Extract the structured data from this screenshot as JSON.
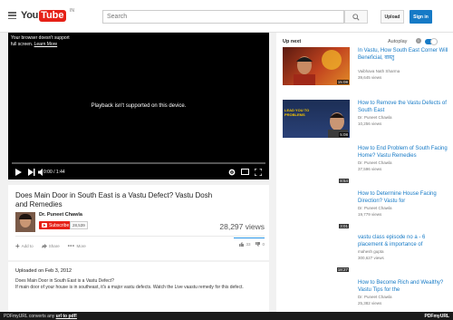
{
  "masthead": {
    "logo_you": "You",
    "logo_tube": "Tube",
    "logo_cc": "IN",
    "search_placeholder": "Search",
    "upload_label": "Upload",
    "signin_label": "Sign in"
  },
  "player": {
    "fullscreen_notice": "Your browser doesn't support full screen.",
    "learn_more": "Learn More",
    "playback_message": "Playback isn't supported on this device.",
    "time": "0:00 / 1:44"
  },
  "video": {
    "title": "Does Main Door in South East is a Vastu Defect? Vastu Dosh and Remedies",
    "channel": "Dr. Puneet Chawla",
    "subscribe_label": "Subscribe",
    "subscriber_count": "28,539",
    "views": "28,297 views",
    "add_to_label": "Add to",
    "share_label": "Share",
    "more_label": "More",
    "likes": "33",
    "dislikes": "0"
  },
  "description": {
    "uploaded": "Uploaded on Feb 3, 2012",
    "line1": "Does Main Door in South East is a Vastu Defect?",
    "line2": "If main door of your house is in southeast, it's a major vastu defects. Watch the Live vaastu remedy for this defect.",
    "show_more": "SHOW MORE"
  },
  "sidebar": {
    "upnext_label": "Up next",
    "autoplay_label": "Autoplay",
    "videos": [
      {
        "title": "In Vastu, How South East Corner Will Beneficial, वास्तु",
        "channel": "Vaibhava Nath Sharma",
        "views": "39,645 views",
        "duration": "15:08"
      },
      {
        "title": "How to Remove the Vastu Defects of South East",
        "channel": "Dr. Puneet Chawla",
        "views": "10,256 views",
        "duration": "5:08",
        "thumb_caption": "LEAD YOU TO PROBLEMS"
      },
      {
        "title": "How to End Problem of South Facing Home? Vastu Remedies",
        "channel": "Dr. Puneet Chawla",
        "views": "37,596 views",
        "duration": "8:54"
      },
      {
        "title": "How to Determine House Facing Direction? Vastu for",
        "channel": "Dr. Puneet Chawla",
        "views": "19,779 views",
        "duration": "3:01"
      },
      {
        "title": "vastu class episode no a - 6 placement & importance of",
        "channel": "mahesh gupta",
        "views": "300,627 views",
        "duration": "18:27"
      },
      {
        "title": "How to Become Rich and Wealthy? Vastu Tips for the",
        "channel": "Dr. Puneet Chawla",
        "views": "25,382 views",
        "duration": ""
      }
    ]
  },
  "pdf_bar": {
    "left_text": "PDFmyURL converts any",
    "left_link": "url to pdf!",
    "right_text": "PDFmyURL"
  },
  "colors": {
    "brand_red": "#e62117",
    "link_blue": "#167ac6"
  }
}
